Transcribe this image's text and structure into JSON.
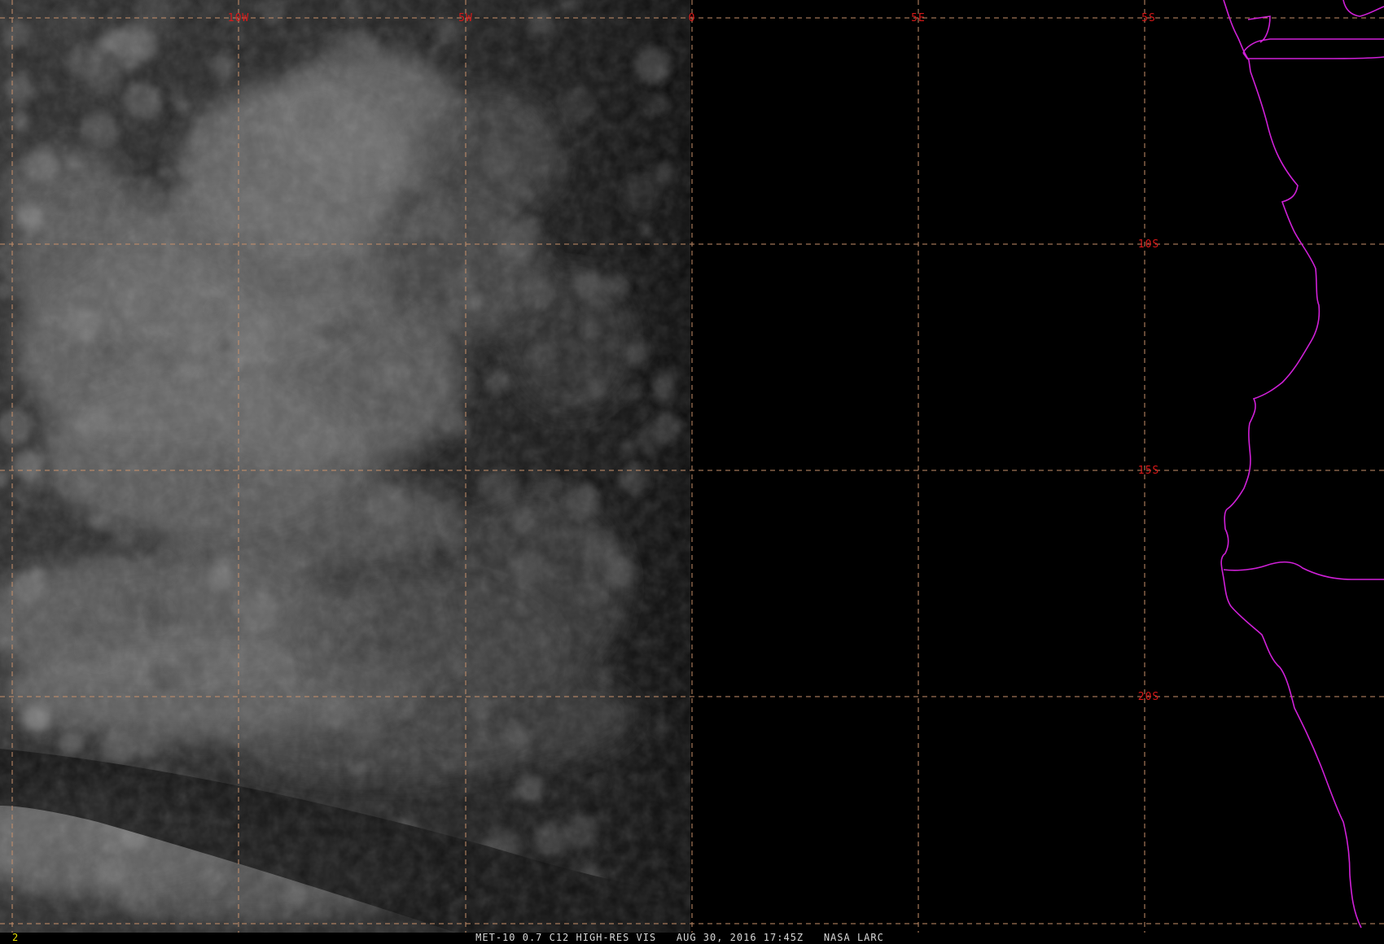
{
  "footer": {
    "frame_number": "2",
    "caption": "MET-10 0.7 C12 HIGH-RES VIS   AUG 30, 2016 17:45Z   NASA LARC"
  },
  "grid": {
    "longitude_labels": [
      "10W",
      "5W",
      "0",
      "5E"
    ],
    "latitude_labels": [
      "5S",
      "10S",
      "15S",
      "20S"
    ]
  },
  "map_layers": {
    "grid_lines": "dashed",
    "coastline": "shown",
    "country_borders": "shown"
  },
  "colors": {
    "background": "#000000",
    "grid_line": "#c8906a",
    "grid_label": "#d81818",
    "coastline": "#d020d8",
    "footer_text": "#d8d8d8",
    "frame_number": "#e8e000",
    "cloud": "#8a8a8a"
  }
}
